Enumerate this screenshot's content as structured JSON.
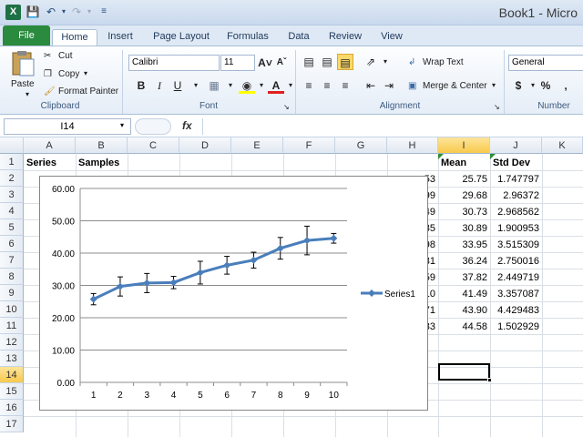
{
  "window": {
    "title": "Book1 - Micro",
    "app_icon": "X"
  },
  "quick_access": [
    "save-icon",
    "undo-icon",
    "undo-dropdown-icon",
    "redo-icon",
    "redo-dropdown-icon",
    "customize-icon"
  ],
  "tabs": [
    "File",
    "Home",
    "Insert",
    "Page Layout",
    "Formulas",
    "Data",
    "Review",
    "View"
  ],
  "ribbon": {
    "clipboard": {
      "label": "Clipboard",
      "paste": "Paste",
      "cut": "Cut",
      "copy": "Copy",
      "format_painter": "Format Painter"
    },
    "font": {
      "label": "Font",
      "name": "Calibri",
      "size": "11",
      "bold": "B",
      "italic": "I",
      "underline": "U",
      "font_color_letter": "A"
    },
    "alignment": {
      "label": "Alignment",
      "wrap_text": "Wrap Text",
      "merge_center": "Merge & Center"
    },
    "number": {
      "label": "Number",
      "format": "General",
      "currency": "$",
      "percent": "%",
      "comma": ","
    }
  },
  "formula_bar": {
    "name_box": "I14",
    "fx": "fx",
    "value": ""
  },
  "columns": [
    "A",
    "B",
    "C",
    "D",
    "E",
    "F",
    "G",
    "H",
    "I",
    "J",
    "K"
  ],
  "rows": [
    "1",
    "2",
    "3",
    "4",
    "5",
    "6",
    "7",
    "8",
    "9",
    "10",
    "11",
    "12",
    "13",
    "14",
    "15",
    "16",
    "17"
  ],
  "selected": {
    "column": "I",
    "row": "14"
  },
  "cells": {
    "A1": "Series",
    "B1": "Samples",
    "I1": "Mean",
    "J1": "Std Dev",
    "H2": "53",
    "H3": "99",
    "H4": "49",
    "H5": "35",
    "H6": "98",
    "H7": "31",
    "H8": "59",
    "H9": "10",
    "H10": "71",
    "H11": "33",
    "I": [
      "25.75",
      "29.68",
      "30.73",
      "30.89",
      "33.95",
      "36.24",
      "37.82",
      "41.49",
      "43.90",
      "44.58"
    ],
    "J": [
      "1.747797",
      "2.96372",
      "2.968562",
      "1.900953",
      "3.515309",
      "2.750016",
      "2.449719",
      "3.357087",
      "4.429483",
      "1.502929"
    ]
  },
  "chart_data": {
    "type": "line",
    "title": "",
    "xlabel": "",
    "ylabel": "",
    "categories": [
      1,
      2,
      3,
      4,
      5,
      6,
      7,
      8,
      9,
      10
    ],
    "series": [
      {
        "name": "Series1",
        "values": [
          25.75,
          29.68,
          30.73,
          30.89,
          33.95,
          36.24,
          37.82,
          41.49,
          43.9,
          44.58
        ],
        "error": [
          1.747797,
          2.96372,
          2.968562,
          1.900953,
          3.515309,
          2.750016,
          2.449719,
          3.357087,
          4.429483,
          1.502929
        ]
      }
    ],
    "ylim": [
      0,
      60
    ],
    "yticks": [
      "0.00",
      "10.00",
      "20.00",
      "30.00",
      "40.00",
      "50.00",
      "60.00"
    ],
    "grid": true,
    "legend": "right",
    "colors": {
      "line": "#4a7ebb"
    }
  }
}
